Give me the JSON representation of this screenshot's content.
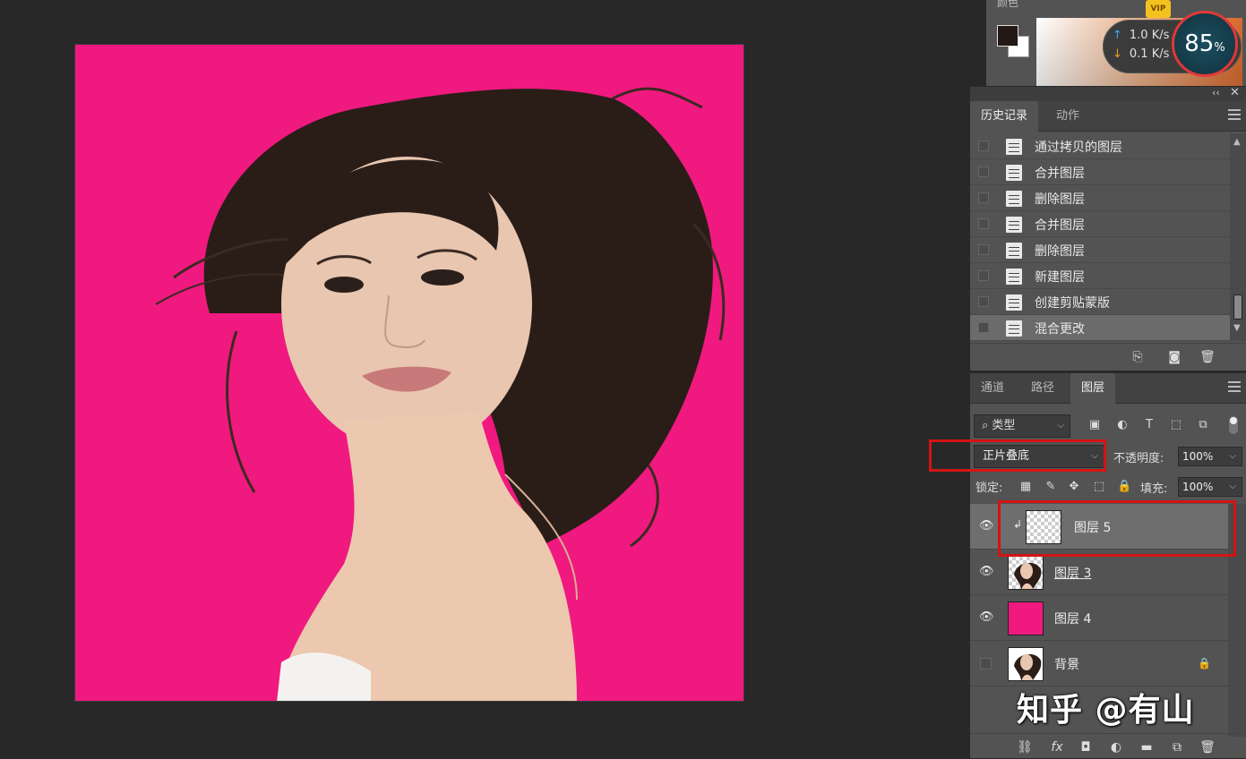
{
  "color_panel": {
    "tab_label": "颜色",
    "foreground": "#231816",
    "background": "#ffffff"
  },
  "speed_widget": {
    "upload": "1.0 K/s",
    "download": "0.1 K/s",
    "percent": "85",
    "percent_sign": "%",
    "vip_label": "VIP"
  },
  "history_panel": {
    "tabs": [
      {
        "label": "历史记录",
        "active": true
      },
      {
        "label": "动作",
        "active": false
      }
    ],
    "items": [
      {
        "label": "通过拷贝的图层",
        "selected": false
      },
      {
        "label": "合并图层",
        "selected": false
      },
      {
        "label": "删除图层",
        "selected": false
      },
      {
        "label": "合并图层",
        "selected": false
      },
      {
        "label": "删除图层",
        "selected": false
      },
      {
        "label": "新建图层",
        "selected": false
      },
      {
        "label": "创建剪贴蒙版",
        "selected": false
      },
      {
        "label": "混合更改",
        "selected": true
      }
    ]
  },
  "layers_panel": {
    "tabs": [
      {
        "label": "通道",
        "active": false
      },
      {
        "label": "路径",
        "active": false
      },
      {
        "label": "图层",
        "active": true
      }
    ],
    "filter": {
      "label": "类型"
    },
    "blend_mode": "正片叠底",
    "opacity_label": "不透明度:",
    "opacity_value": "100%",
    "lock_label": "锁定:",
    "fill_label": "填充:",
    "fill_value": "100%",
    "layers": [
      {
        "name": "图层 5",
        "visible": true,
        "selected": true,
        "clipped": true,
        "thumb": "checker"
      },
      {
        "name": "图层 3",
        "visible": true,
        "selected": false,
        "clipped": false,
        "thumb": "photo"
      },
      {
        "name": "图层 4",
        "visible": true,
        "selected": false,
        "clipped": false,
        "thumb": "pink"
      },
      {
        "name": "背景",
        "visible": false,
        "selected": false,
        "clipped": false,
        "thumb": "photo",
        "locked": true
      }
    ]
  },
  "canvas": {
    "background_color": "#f0197f"
  },
  "watermark": "知乎 @有山",
  "colors": {
    "highlight_box": "#d31414",
    "panel_bg": "#535353",
    "workspace_bg": "#282828"
  }
}
